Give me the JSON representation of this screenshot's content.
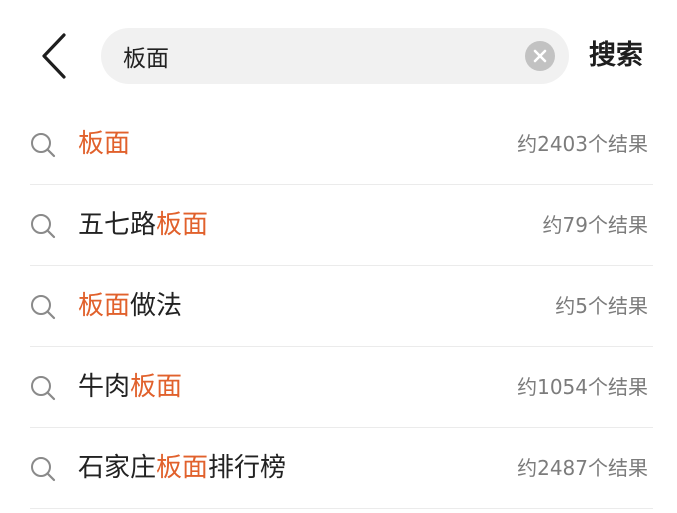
{
  "search": {
    "query": "板面",
    "submit_label": "搜索"
  },
  "colors": {
    "highlight": "#e1612c",
    "search_box_bg": "#f1f1f1",
    "count_text": "#7c7c7c"
  },
  "icons": {
    "back": "chevron-left-icon",
    "clear": "clear-circle-icon",
    "suggestion": "search-icon"
  },
  "suggestions": [
    {
      "pre": "",
      "hl": "板面",
      "post": "",
      "count": "约2403个结果"
    },
    {
      "pre": "五七路",
      "hl": "板面",
      "post": "",
      "count": "约79个结果"
    },
    {
      "pre": "",
      "hl": "板面",
      "post": "做法",
      "count": "约5个结果"
    },
    {
      "pre": "牛肉",
      "hl": "板面",
      "post": "",
      "count": "约1054个结果"
    },
    {
      "pre": "石家庄",
      "hl": "板面",
      "post": "排行榜",
      "count": "约2487个结果"
    }
  ]
}
